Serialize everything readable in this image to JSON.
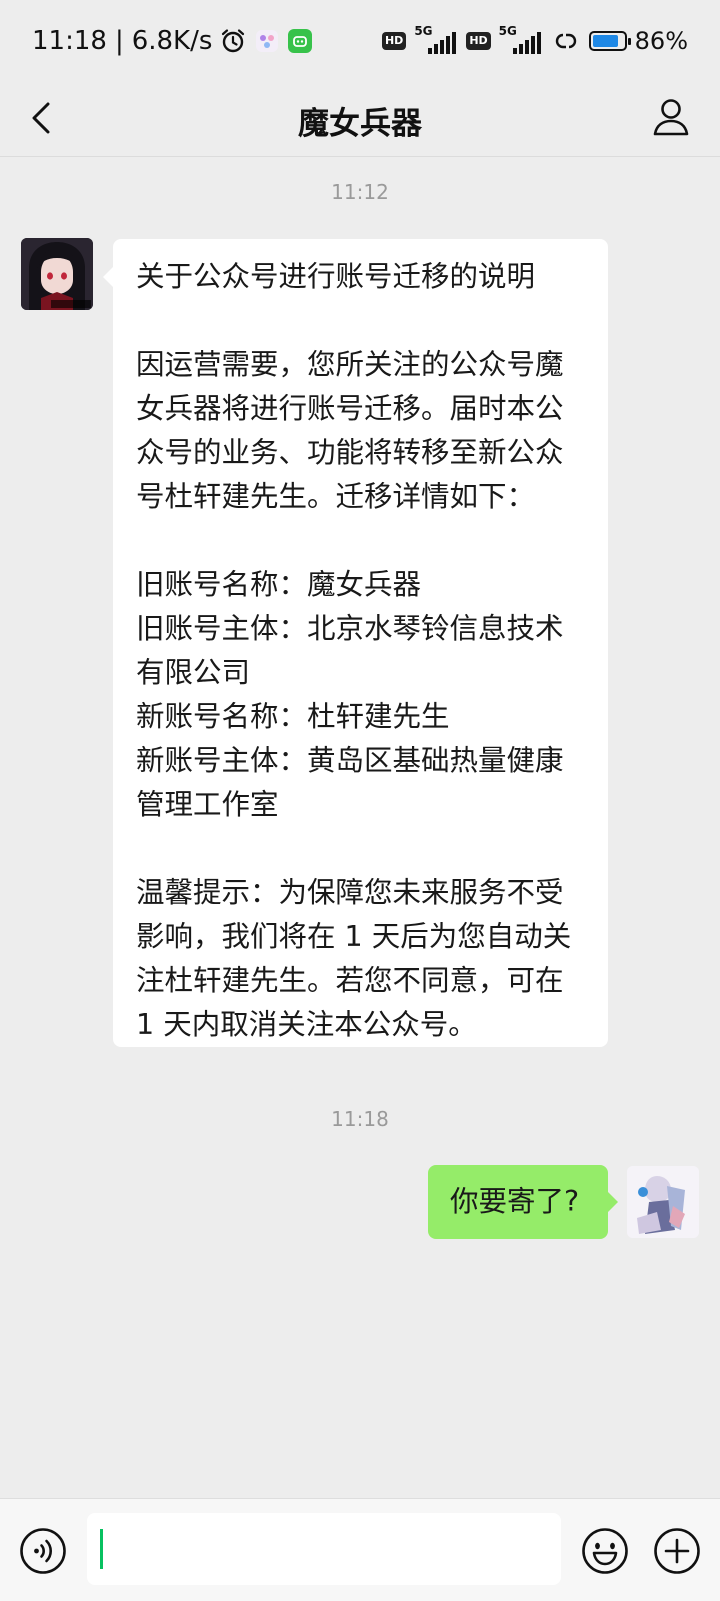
{
  "status_bar": {
    "time": "11:18",
    "separator": "|",
    "net_speed": "6.8K/s",
    "hd1": "HD",
    "sim1_gen": "5G",
    "hd2": "HD",
    "sim2_gen": "5G",
    "battery_percent": "86%",
    "battery_level": 0.86,
    "battery_color": "#1e88e5",
    "icons": [
      "alarm-icon",
      "app-icon",
      "app-icon-green",
      "link-icon"
    ]
  },
  "header": {
    "title": "魔女兵器",
    "back_icon": "chevron-left-icon",
    "profile_icon": "person-icon"
  },
  "chat": {
    "timestamp_1": "11:12",
    "incoming": {
      "paragraphs": [
        "关于公众号进行账号迁移的说明",
        "",
        "因运营需要，您所关注的公众号魔女兵器将进行账号迁移。届时本公众号的业务、功能将转移至新公众号杜轩建先生。迁移详情如下：",
        "",
        "旧账号名称：魔女兵器",
        "旧账号主体：北京水琴铃信息技术有限公司",
        "新账号名称：杜轩建先生",
        "新账号主体：黄岛区基础热量健康管理工作室",
        "",
        "温馨提示：为保障您未来服务不受影响，我们将在 1 天后为您自动关注杜轩建先生。若您不同意，可在 1 天内取消关注本公众号。"
      ]
    },
    "timestamp_2": "11:18",
    "outgoing": {
      "text": "你要寄了?"
    }
  },
  "input_bar": {
    "value": "",
    "voice_icon": "voice-icon",
    "emoji_icon": "emoji-icon",
    "add_icon": "plus-icon"
  },
  "colors": {
    "background": "#ededed",
    "incoming_bubble": "#ffffff",
    "outgoing_bubble": "#95ec69",
    "accent": "#07c160"
  }
}
